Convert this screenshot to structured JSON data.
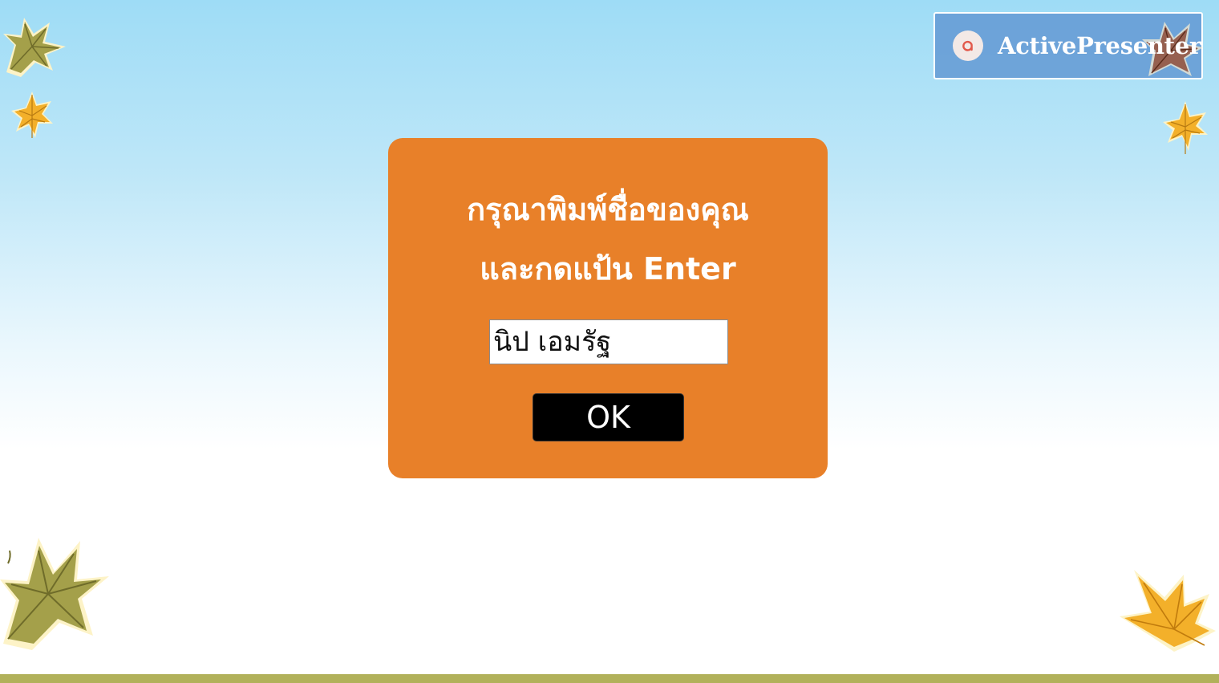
{
  "brand": {
    "name": "ActivePresenter",
    "logo_icon": "activepresenter-logo-icon"
  },
  "dialog": {
    "prompt_line1": "กรุณาพิมพ์ชื่อของคุณ",
    "prompt_line2": "และกดแป้น Enter",
    "name_input_value": "นิป เอมรัฐ",
    "ok_label": "OK"
  },
  "decorations": {
    "leaf_icon": "maple-leaf-icon"
  },
  "colors": {
    "dialog_background": "#e88029",
    "button_background": "#000000",
    "bottom_bar": "#b1b15a",
    "brand_panel": "#6096d2",
    "leaf_olive": "#a4a04a",
    "leaf_orange": "#f3b02a",
    "leaf_brown": "#8b3a22"
  }
}
